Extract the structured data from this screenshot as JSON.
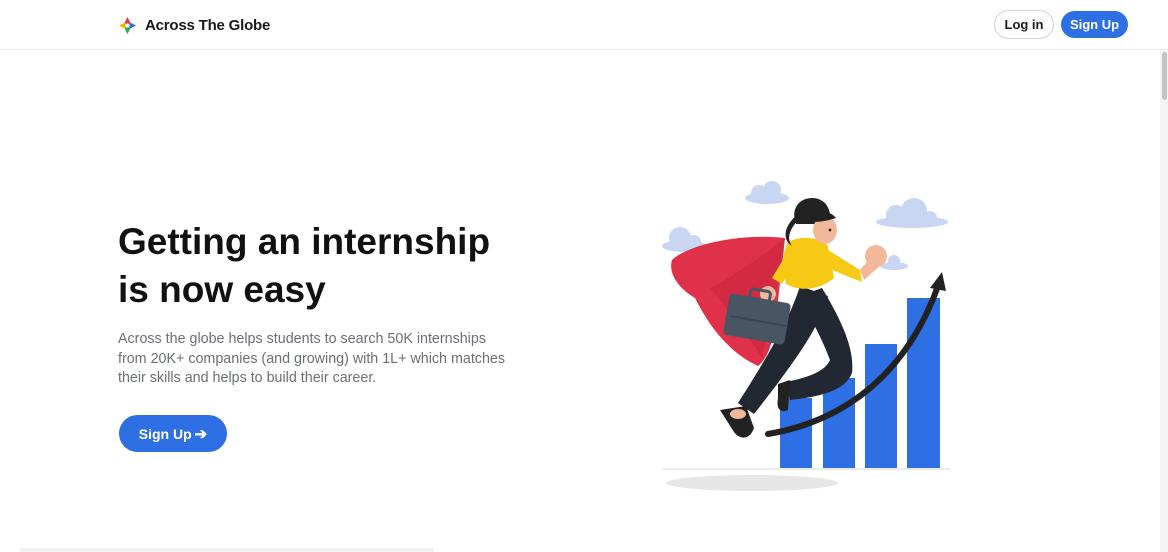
{
  "nav": {
    "brand_name": "Across The Globe",
    "login_label": "Log in",
    "signup_label": "Sign Up"
  },
  "hero": {
    "title_line1": "Getting an internship",
    "title_line2": "is now easy",
    "description": "Across the globe helps students to search 50K internships from 20K+ companies (and growing) with 1L+ which matches their skills and helps to build their career.",
    "cta_label": "Sign Up",
    "cta_icon": "arrow-right-icon"
  },
  "colors": {
    "primary": "#2f6fe4",
    "heading": "#111111",
    "body_text": "#6b6f76",
    "cape": "#e0314b",
    "shirt": "#f6c915",
    "bars": "#2f6fe4",
    "clouds": "#c9d6f2"
  },
  "icons": {
    "logo": "compass-logo-icon"
  }
}
